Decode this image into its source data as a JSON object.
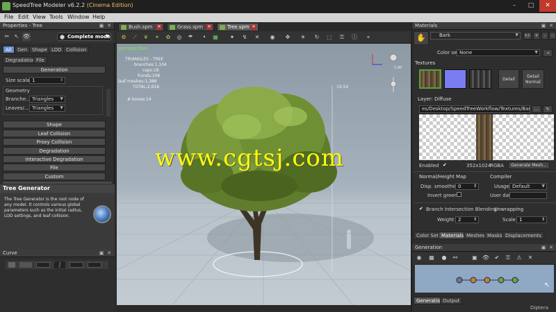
{
  "window": {
    "title": "SpeedTree Modeler v6.2.2",
    "edition": "(Cinema Edition)",
    "min": "–",
    "max": "□",
    "close": "✕"
  },
  "menu": [
    "File",
    "Edit",
    "View",
    "Tools",
    "Window",
    "Help"
  ],
  "properties": {
    "header": "Properties - Tree",
    "mode": "Complete mode",
    "tabs": [
      "All",
      "Gen",
      "Shape",
      "LOD",
      "Collision"
    ],
    "tabs2": [
      "Degradation",
      "File"
    ],
    "generation_btn": "Generation",
    "size_scalar_label": "Size scalar",
    "size_scalar_value": "1",
    "geometry_label": "Geometry",
    "branches_label": "Branche...",
    "branches_value": "Triangles",
    "leaves_label": "Leaves/...",
    "leaves_value": "Triangles",
    "sections": [
      "Shape",
      "Leaf Collision",
      "Proxy Collision",
      "Degradation",
      "Interactive Degradation",
      "File",
      "Custom"
    ]
  },
  "tree_generator": {
    "title": "Tree Generator",
    "description": "The Tree Generator is the root node of any model. It controls various global parameters such as the initial radius, LOD settings, and leaf collision."
  },
  "curve": {
    "header": "Curve"
  },
  "doc_tabs": [
    {
      "label": "Bush.spm",
      "active": false
    },
    {
      "label": "Grass.spm",
      "active": false
    },
    {
      "label": "Tree.spm",
      "active": true
    }
  ],
  "viewport": {
    "mode": "perspective",
    "stats_title": "TRIANGLES - TREE",
    "stats": [
      "branches:1,104",
      "caps:18",
      "fronds:106",
      "leaf meshes:1,388",
      "TOTAL:2,616"
    ],
    "bones": "# bones:14",
    "axis_label": "19.54",
    "light_label": "1.00",
    "watermark": "www.cgtsj.com"
  },
  "materials": {
    "header": "Materials",
    "material_name": "Bark",
    "color_set_label": "Color set",
    "color_set_value": "None",
    "textures_label": "Textures",
    "detail_btn": "Detail",
    "detail_normal_btn": "Detail\nNormal",
    "layer_label": "Layer: Diffuse",
    "path": "es/Desktop/SpeedTreeWorkflow/Textures/Bark.tif",
    "browse": "...",
    "enabled_label": "Enabled",
    "resolution": "352x1024",
    "format": "RGBA",
    "generate_mesh": "Generate Mesh...",
    "normal_height_label": "Normal/Height Map",
    "disp_smoothing_label": "Disp. smoothing",
    "disp_smoothing_value": "0",
    "invert_green_label": "Invert green",
    "compiler_label": "Compiler",
    "usage_label": "Usage",
    "usage_value": "Default",
    "user_data_label": "User data",
    "branch_blend_label": "Branch Intersection Blending",
    "weight_label": "Weight",
    "weight_value": "2",
    "unwrapping_label": "Unwrapping",
    "scale_label": "Scale",
    "scale_value": "1",
    "bottom_tabs": [
      "Color Sets",
      "Materials",
      "Meshes",
      "Masks",
      "Displacements"
    ]
  },
  "generation": {
    "header": "Generation",
    "bottom_tabs": [
      "Generation",
      "Output"
    ],
    "credit": "Diptera"
  },
  "colors": {
    "accent_tab": "#6a8ed0",
    "viewport_green": "#8fe060",
    "watermark": "#ffff00"
  }
}
